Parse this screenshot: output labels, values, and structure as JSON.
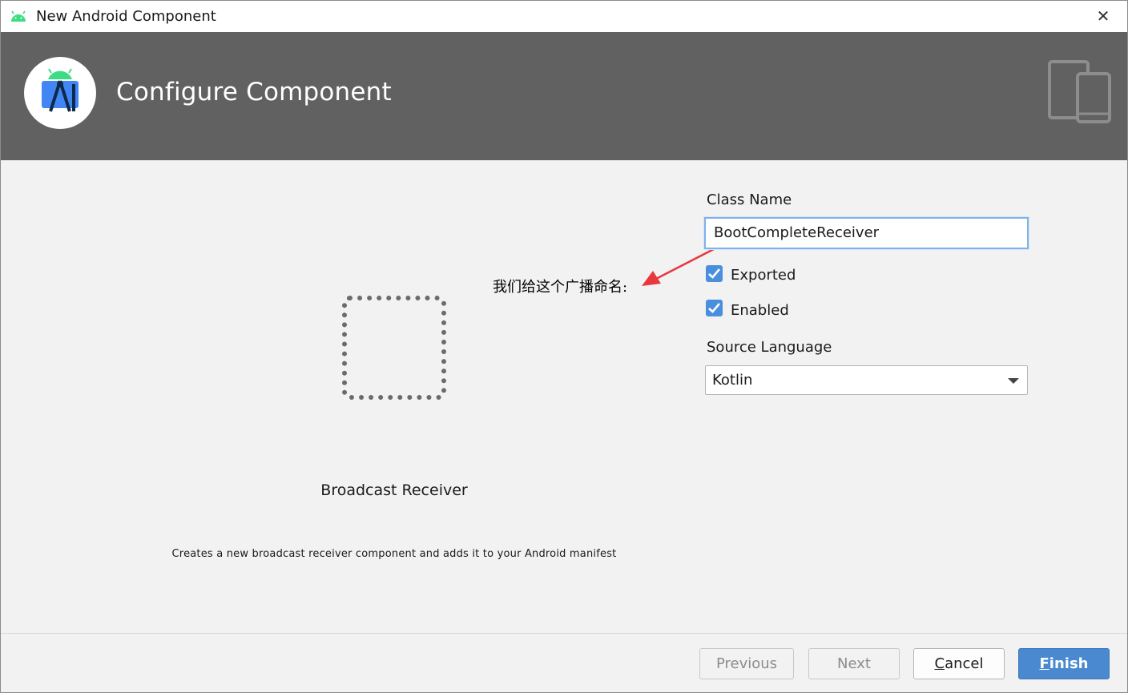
{
  "window": {
    "title": "New Android Component",
    "close_glyph": "✕"
  },
  "banner": {
    "heading": "Configure Component",
    "logo_icon": "android-studio-logo-icon",
    "devices_icon": "phone-tablet-devices-icon"
  },
  "component": {
    "name": "Broadcast Receiver",
    "description": "Creates a new broadcast receiver component and adds it to your Android manifest"
  },
  "annotation": {
    "text": "我们给这个广播命名:",
    "arrow_color": "#e8383d"
  },
  "form": {
    "class_name_label": "Class Name",
    "class_name_value": "BootCompleteReceiver",
    "exported_label": "Exported",
    "exported_checked": true,
    "enabled_label": "Enabled",
    "enabled_checked": true,
    "source_language_label": "Source Language",
    "source_language_value": "Kotlin"
  },
  "buttons": {
    "previous": "Previous",
    "next": "Next",
    "cancel_mnemonic": "C",
    "cancel_rest": "ancel",
    "finish_mnemonic": "F",
    "finish_rest": "inish"
  },
  "colors": {
    "banner": "#616161",
    "accent": "#4a88d0",
    "checkbox": "#4a8fde"
  }
}
